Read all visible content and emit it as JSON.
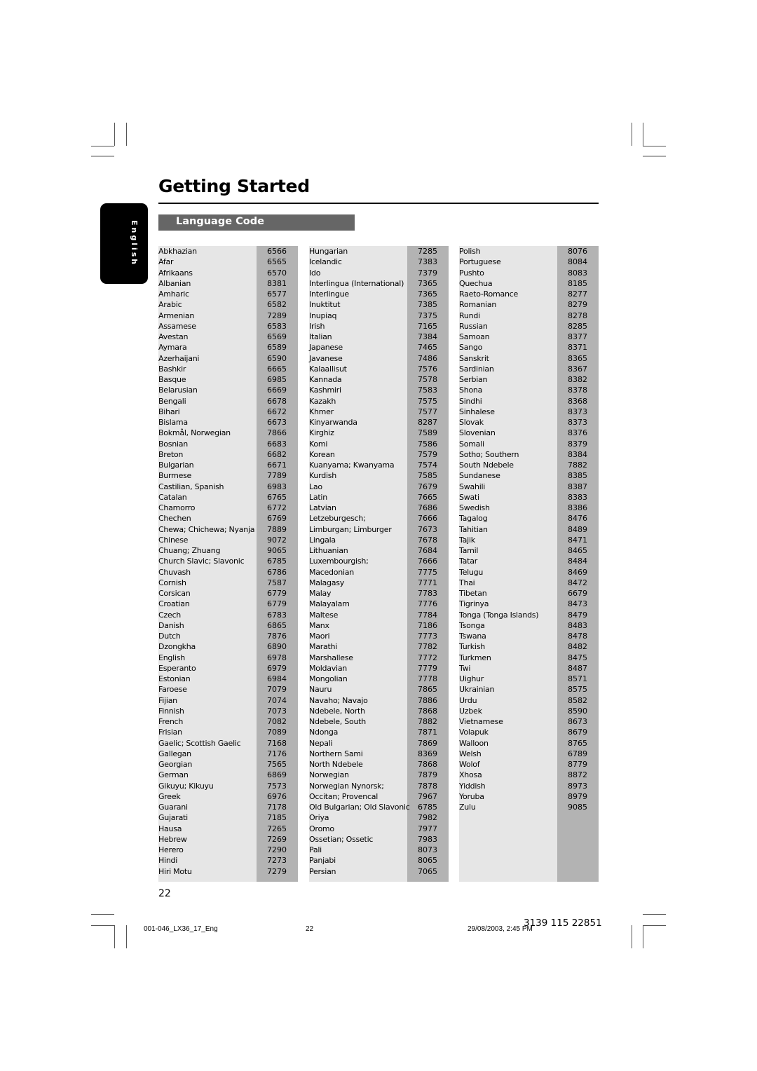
{
  "header": {
    "title": "Getting Started",
    "section": "Language Code",
    "side_tab": "English"
  },
  "columns": [
    {
      "rows": [
        {
          "language": "Abkhazian",
          "code": "6566"
        },
        {
          "language": "Afar",
          "code": "6565"
        },
        {
          "language": "Afrikaans",
          "code": "6570"
        },
        {
          "language": "Albanian",
          "code": "8381"
        },
        {
          "language": "Amharic",
          "code": "6577"
        },
        {
          "language": "Arabic",
          "code": "6582"
        },
        {
          "language": "Armenian",
          "code": "7289"
        },
        {
          "language": "Assamese",
          "code": "6583"
        },
        {
          "language": "Avestan",
          "code": "6569"
        },
        {
          "language": "Aymara",
          "code": "6589"
        },
        {
          "language": "Azerhaijani",
          "code": "6590"
        },
        {
          "language": "Bashkir",
          "code": "6665"
        },
        {
          "language": "Basque",
          "code": "6985"
        },
        {
          "language": "Belarusian",
          "code": "6669"
        },
        {
          "language": "Bengali",
          "code": "6678"
        },
        {
          "language": "Bihari",
          "code": "6672"
        },
        {
          "language": "Bislama",
          "code": "6673"
        },
        {
          "language": "Bokmål, Norwegian",
          "code": "7866"
        },
        {
          "language": "Bosnian",
          "code": "6683"
        },
        {
          "language": "Breton",
          "code": "6682"
        },
        {
          "language": "Bulgarian",
          "code": "6671"
        },
        {
          "language": "Burmese",
          "code": "7789"
        },
        {
          "language": "Castilian, Spanish",
          "code": "6983"
        },
        {
          "language": "Catalan",
          "code": "6765"
        },
        {
          "language": "Chamorro",
          "code": "6772"
        },
        {
          "language": "Chechen",
          "code": "6769"
        },
        {
          "language": "Chewa; Chichewa; Nyanja",
          "code": "7889"
        },
        {
          "language": "Chinese",
          "code": "9072"
        },
        {
          "language": "Chuang; Zhuang",
          "code": "9065"
        },
        {
          "language": "Church Slavic; Slavonic",
          "code": "6785"
        },
        {
          "language": "Chuvash",
          "code": "6786"
        },
        {
          "language": "Cornish",
          "code": "7587"
        },
        {
          "language": "Corsican",
          "code": "6779"
        },
        {
          "language": "Croatian",
          "code": "6779"
        },
        {
          "language": "Czech",
          "code": "6783"
        },
        {
          "language": "Danish",
          "code": "6865"
        },
        {
          "language": "Dutch",
          "code": "7876"
        },
        {
          "language": "Dzongkha",
          "code": "6890"
        },
        {
          "language": "English",
          "code": "6978"
        },
        {
          "language": "Esperanto",
          "code": "6979"
        },
        {
          "language": "Estonian",
          "code": "6984"
        },
        {
          "language": "Faroese",
          "code": "7079"
        },
        {
          "language": "Fijian",
          "code": "7074"
        },
        {
          "language": "Finnish",
          "code": "7073"
        },
        {
          "language": "French",
          "code": "7082"
        },
        {
          "language": "Frisian",
          "code": "7089"
        },
        {
          "language": "Gaelic; Scottish Gaelic",
          "code": "7168"
        },
        {
          "language": "Gallegan",
          "code": "7176"
        },
        {
          "language": "Georgian",
          "code": "7565"
        },
        {
          "language": "German",
          "code": "6869"
        },
        {
          "language": "Gikuyu; Kikuyu",
          "code": "7573"
        },
        {
          "language": "Greek",
          "code": "6976"
        },
        {
          "language": "Guarani",
          "code": "7178"
        },
        {
          "language": "Gujarati",
          "code": "7185"
        },
        {
          "language": "Hausa",
          "code": "7265"
        },
        {
          "language": "Hebrew",
          "code": "7269"
        },
        {
          "language": "Herero",
          "code": "7290"
        },
        {
          "language": "Hindi",
          "code": "7273"
        },
        {
          "language": "Hiri Motu",
          "code": "7279"
        }
      ]
    },
    {
      "rows": [
        {
          "language": "Hungarian",
          "code": "7285"
        },
        {
          "language": "Icelandic",
          "code": "7383"
        },
        {
          "language": "Ido",
          "code": "7379"
        },
        {
          "language": "Interlingua (International)",
          "code": "7365"
        },
        {
          "language": "Interlingue",
          "code": "7365"
        },
        {
          "language": "Inuktitut",
          "code": "7385"
        },
        {
          "language": "Inupiaq",
          "code": "7375"
        },
        {
          "language": "Irish",
          "code": "7165"
        },
        {
          "language": "Italian",
          "code": "7384"
        },
        {
          "language": "Japanese",
          "code": "7465"
        },
        {
          "language": "Javanese",
          "code": "7486"
        },
        {
          "language": "Kalaallisut",
          "code": "7576"
        },
        {
          "language": "Kannada",
          "code": "7578"
        },
        {
          "language": "Kashmiri",
          "code": "7583"
        },
        {
          "language": "Kazakh",
          "code": "7575"
        },
        {
          "language": "Khmer",
          "code": "7577"
        },
        {
          "language": "Kinyarwanda",
          "code": "8287"
        },
        {
          "language": "Kirghiz",
          "code": "7589"
        },
        {
          "language": "Komi",
          "code": "7586"
        },
        {
          "language": "Korean",
          "code": "7579"
        },
        {
          "language": "Kuanyama; Kwanyama",
          "code": "7574"
        },
        {
          "language": "Kurdish",
          "code": "7585"
        },
        {
          "language": "Lao",
          "code": "7679"
        },
        {
          "language": "Latin",
          "code": "7665"
        },
        {
          "language": "Latvian",
          "code": "7686"
        },
        {
          "language": "Letzeburgesch;",
          "code": "7666"
        },
        {
          "language": "Limburgan; Limburger",
          "code": "7673"
        },
        {
          "language": "Lingala",
          "code": "7678"
        },
        {
          "language": "Lithuanian",
          "code": "7684"
        },
        {
          "language": "Luxembourgish;",
          "code": "7666"
        },
        {
          "language": "Macedonian",
          "code": "7775"
        },
        {
          "language": "Malagasy",
          "code": "7771"
        },
        {
          "language": "Malay",
          "code": "7783"
        },
        {
          "language": "Malayalam",
          "code": "7776"
        },
        {
          "language": "Maltese",
          "code": "7784"
        },
        {
          "language": "Manx",
          "code": "7186"
        },
        {
          "language": "Maori",
          "code": "7773"
        },
        {
          "language": "Marathi",
          "code": "7782"
        },
        {
          "language": "Marshallese",
          "code": "7772"
        },
        {
          "language": "Moldavian",
          "code": "7779"
        },
        {
          "language": "Mongolian",
          "code": "7778"
        },
        {
          "language": "Nauru",
          "code": "7865"
        },
        {
          "language": "Navaho; Navajo",
          "code": "7886"
        },
        {
          "language": "Ndebele, North",
          "code": "7868"
        },
        {
          "language": "Ndebele, South",
          "code": "7882"
        },
        {
          "language": "Ndonga",
          "code": "7871"
        },
        {
          "language": "Nepali",
          "code": "7869"
        },
        {
          "language": "Northern Sami",
          "code": "8369"
        },
        {
          "language": "North Ndebele",
          "code": "7868"
        },
        {
          "language": "Norwegian",
          "code": "7879"
        },
        {
          "language": "Norwegian Nynorsk;",
          "code": "7878"
        },
        {
          "language": "Occitan; Provencal",
          "code": "7967"
        },
        {
          "language": "Old Bulgarian; Old Slavonic",
          "code": "6785"
        },
        {
          "language": "Oriya",
          "code": "7982"
        },
        {
          "language": "Oromo",
          "code": "7977"
        },
        {
          "language": "Ossetian; Ossetic",
          "code": "7983"
        },
        {
          "language": "Pali",
          "code": "8073"
        },
        {
          "language": "Panjabi",
          "code": "8065"
        },
        {
          "language": "Persian",
          "code": "7065"
        }
      ]
    },
    {
      "rows": [
        {
          "language": "Polish",
          "code": "8076"
        },
        {
          "language": "Portuguese",
          "code": "8084"
        },
        {
          "language": "Pushto",
          "code": "8083"
        },
        {
          "language": "Quechua",
          "code": "8185"
        },
        {
          "language": "Raeto-Romance",
          "code": "8277"
        },
        {
          "language": "Romanian",
          "code": "8279"
        },
        {
          "language": "Rundi",
          "code": "8278"
        },
        {
          "language": "Russian",
          "code": "8285"
        },
        {
          "language": "Samoan",
          "code": "8377"
        },
        {
          "language": "Sango",
          "code": "8371"
        },
        {
          "language": "Sanskrit",
          "code": "8365"
        },
        {
          "language": "Sardinian",
          "code": "8367"
        },
        {
          "language": "Serbian",
          "code": "8382"
        },
        {
          "language": "Shona",
          "code": "8378"
        },
        {
          "language": "Sindhi",
          "code": "8368"
        },
        {
          "language": "Sinhalese",
          "code": "8373"
        },
        {
          "language": "Slovak",
          "code": "8373"
        },
        {
          "language": "Slovenian",
          "code": "8376"
        },
        {
          "language": "Somali",
          "code": "8379"
        },
        {
          "language": "Sotho; Southern",
          "code": "8384"
        },
        {
          "language": "South Ndebele",
          "code": "7882"
        },
        {
          "language": "Sundanese",
          "code": "8385"
        },
        {
          "language": "Swahili",
          "code": "8387"
        },
        {
          "language": "Swati",
          "code": "8383"
        },
        {
          "language": "Swedish",
          "code": "8386"
        },
        {
          "language": "Tagalog",
          "code": "8476"
        },
        {
          "language": "Tahitian",
          "code": "8489"
        },
        {
          "language": "Tajik",
          "code": "8471"
        },
        {
          "language": "Tamil",
          "code": "8465"
        },
        {
          "language": "Tatar",
          "code": "8484"
        },
        {
          "language": "Telugu",
          "code": "8469"
        },
        {
          "language": "Thai",
          "code": "8472"
        },
        {
          "language": "Tibetan",
          "code": "6679"
        },
        {
          "language": "Tigrinya",
          "code": "8473"
        },
        {
          "language": "Tonga (Tonga Islands)",
          "code": "8479"
        },
        {
          "language": "Tsonga",
          "code": "8483"
        },
        {
          "language": "Tswana",
          "code": "8478"
        },
        {
          "language": "Turkish",
          "code": "8482"
        },
        {
          "language": "Turkmen",
          "code": "8475"
        },
        {
          "language": "Twi",
          "code": "8487"
        },
        {
          "language": "Uighur",
          "code": "8571"
        },
        {
          "language": "Ukrainian",
          "code": "8575"
        },
        {
          "language": "Urdu",
          "code": "8582"
        },
        {
          "language": "Uzbek",
          "code": "8590"
        },
        {
          "language": "Vietnamese",
          "code": "8673"
        },
        {
          "language": "Volapuk",
          "code": "8679"
        },
        {
          "language": "Walloon",
          "code": "8765"
        },
        {
          "language": "Welsh",
          "code": "6789"
        },
        {
          "language": "Wolof",
          "code": "8779"
        },
        {
          "language": "Xhosa",
          "code": "8872"
        },
        {
          "language": "Yiddish",
          "code": "8973"
        },
        {
          "language": "Yoruba",
          "code": "8979"
        },
        {
          "language": "Zulu",
          "code": "9085"
        }
      ]
    }
  ],
  "footer": {
    "page_number": "22",
    "file_name": "001-046_LX36_17_Eng",
    "file_page": "22",
    "timestamp": "29/08/2003, 2:45 PM",
    "part_number": "3139 115 22851"
  }
}
